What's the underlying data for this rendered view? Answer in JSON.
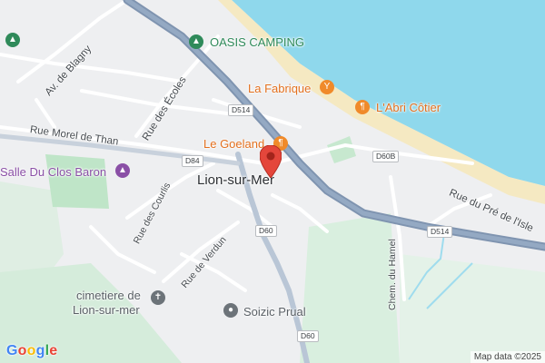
{
  "map": {
    "city": "Lion-sur-Mer",
    "streets": {
      "av_de_blagny": "Av. de Blagny",
      "rue_morel_de_than": "Rue Morel de Than",
      "rue_des_ecoles": "Rue des Écoles",
      "rue_des_courlis": "Rue des Courlis",
      "rue_de_verdun": "Rue de Verdun",
      "rue_du_pre_de_lisle": "Rue du Pré de l'Isle",
      "chem_du_hamel": "Chem. du Hamel"
    },
    "shields": {
      "d514_top": "D514",
      "d514_right": "D514",
      "d84": "D84",
      "d60b": "D60B",
      "d60_mid": "D60",
      "d60_bottom": "D60"
    },
    "pois": {
      "oasis_camping": "OASIS CAMPING",
      "la_fabrique": "La Fabrique",
      "abri_cotier": "L'Abri Côtier",
      "le_goeland": "Le Goeland",
      "salle_du_clos_baron": "Salle Du Clos Baron",
      "cimetiere": [
        "cimetiere de",
        "Lion-sur-mer"
      ],
      "soizic_prual": "Soizic Prual"
    },
    "icons": {
      "camping": "camping-icon",
      "bar": "cocktail-icon",
      "restaurant": "fork-knife-icon",
      "venue": "landmark-icon",
      "cemetery": "cemetery-icon",
      "place": "place-icon",
      "pin": "map-pin-icon"
    },
    "colors": {
      "sea": "#8fd8ec",
      "beach": "#f5e9c2",
      "land": "#eeeff1",
      "park": "#c7e8cf",
      "motorway": "#8ea3bd",
      "pin": "#e4463b"
    }
  },
  "footer": {
    "logo": "Google",
    "attribution": "Map data ©2025"
  }
}
